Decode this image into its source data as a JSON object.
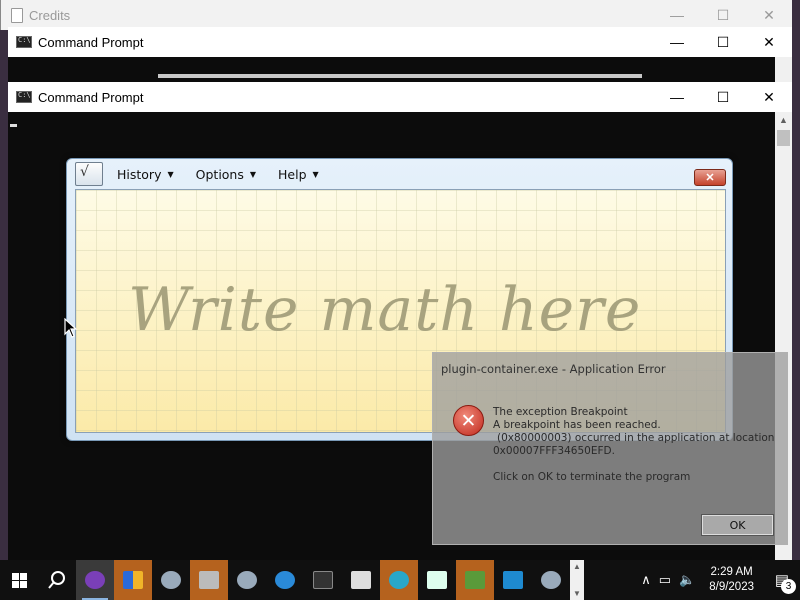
{
  "credits_window": {
    "title": "Credits"
  },
  "cmd_window_back": {
    "title": "Command Prompt"
  },
  "cmd_window_front": {
    "title": "Command Prompt"
  },
  "window_controls": {
    "minimize": "—",
    "maximize": "☐",
    "close": "✕"
  },
  "math_panel": {
    "menus": [
      {
        "label": "History"
      },
      {
        "label": "Options"
      },
      {
        "label": "Help"
      }
    ],
    "close_label": "✕",
    "hint": "Write math here"
  },
  "error_dialog": {
    "title": "plugin-container.exe - Application Error",
    "line1": "The exception Breakpoint",
    "line2": "A breakpoint has been reached.",
    "line3": "(0x80000003) occurred in the application at location",
    "line4": "0x00007FFF34650EFD.",
    "footer": "Click on OK to terminate the program",
    "ok_label": "OK",
    "icon_glyph": "✕"
  },
  "taskbar": {
    "clock_time": "2:29 AM",
    "clock_date": "8/9/2023",
    "notification_count": "3",
    "apps": [
      {
        "name": "glasses-app-icon",
        "color": "#7a3fb8"
      },
      {
        "name": "shield-app-icon",
        "color": "#f0b429"
      },
      {
        "name": "cd-app-icon",
        "color": "#9ab"
      },
      {
        "name": "printer-app-icon",
        "color": "#aaa"
      },
      {
        "name": "cd-app-icon-2",
        "color": "#9ab"
      },
      {
        "name": "ie-app-icon",
        "color": "#2a8ad8"
      },
      {
        "name": "terminal-app-icon",
        "color": "#333"
      },
      {
        "name": "window-app-icon",
        "color": "#ddd"
      },
      {
        "name": "edge-app-icon",
        "color": "#2aa7c9"
      },
      {
        "name": "image-app-icon",
        "color": "#cfd"
      },
      {
        "name": "chart-app-icon",
        "color": "#5a9a3a"
      },
      {
        "name": "blue-window-app-icon",
        "color": "#1e8ad0"
      },
      {
        "name": "cd-app-icon-3",
        "color": "#9ab"
      }
    ]
  }
}
